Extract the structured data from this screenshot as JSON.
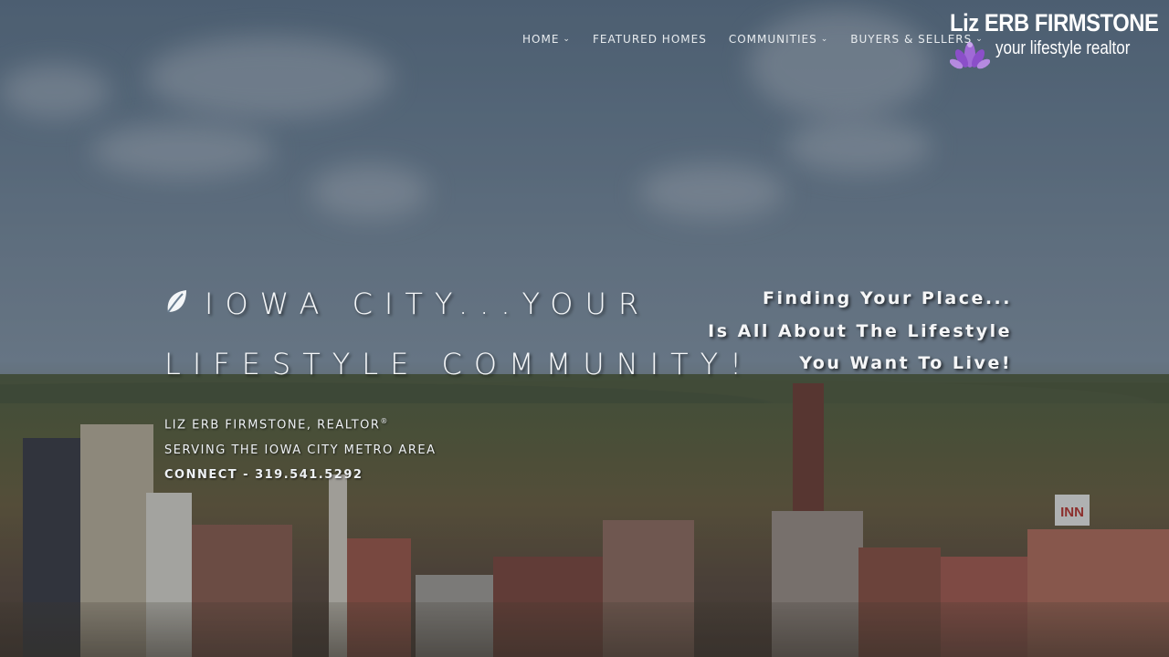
{
  "nav": {
    "items": [
      {
        "label": "HOME",
        "has_dropdown": true,
        "icon": "chevron-down-icon"
      },
      {
        "label": "FEATURED HOMES",
        "has_dropdown": false
      },
      {
        "label": "COMMUNITIES",
        "has_dropdown": true,
        "icon": "chevron-down-icon"
      },
      {
        "label": "BUYERS & SELLERS",
        "has_dropdown": true,
        "icon": "chevron-down-icon"
      }
    ]
  },
  "logo": {
    "name": "Liz ERB FIRMSTONE",
    "tagline": "your lifestyle realtor",
    "icon": "lotus-icon",
    "accent_color": "#8b4fc9"
  },
  "hero": {
    "headline_line1": "IOWA CITY...YOUR",
    "headline_line2": "LIFESTYLE COMMUNITY!",
    "headline_icon": "leaf-icon",
    "right_line1": "Finding Your Place...",
    "right_line2": "Is All About The Lifestyle",
    "right_line3": "You Want To Live!",
    "info_name": "LIZ ERB FIRMSTONE, REALTOR",
    "info_registered": "®",
    "info_area": "SERVING THE IOWA CITY METRO AREA",
    "info_connect": "CONNECT - 319.541.5292",
    "sign_text": "INN"
  }
}
